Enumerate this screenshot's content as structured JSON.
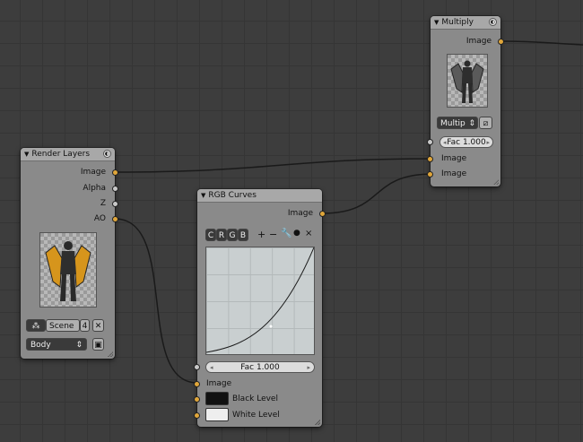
{
  "colors": {
    "socket_color": "#e0a63a",
    "socket_value": "#c8c8c8",
    "black_level": "#111111",
    "white_level": "#eeeeee",
    "background": "#3d3d3d",
    "node_body": "#8a8a8a"
  },
  "render_layers": {
    "title": "Render Layers",
    "outputs": [
      "Image",
      "Alpha",
      "Z",
      "AO"
    ],
    "scene_label": "Scene",
    "scene_users": "4",
    "layer_label": "Body"
  },
  "rgb_curves": {
    "title": "RGB Curves",
    "output": "Image",
    "channels": [
      "C",
      "R",
      "G",
      "B"
    ],
    "tools": [
      "+",
      "−",
      "wrench",
      "●",
      "×"
    ],
    "fac_label": "Fac 1.000",
    "inputs": [
      "Image",
      "Black Level",
      "White Level"
    ]
  },
  "multiply": {
    "title": "Multiply",
    "output": "Image",
    "blend_mode": "Multip",
    "fac_label": "Fac 1.000",
    "inputs": [
      "Image",
      "Image"
    ]
  }
}
